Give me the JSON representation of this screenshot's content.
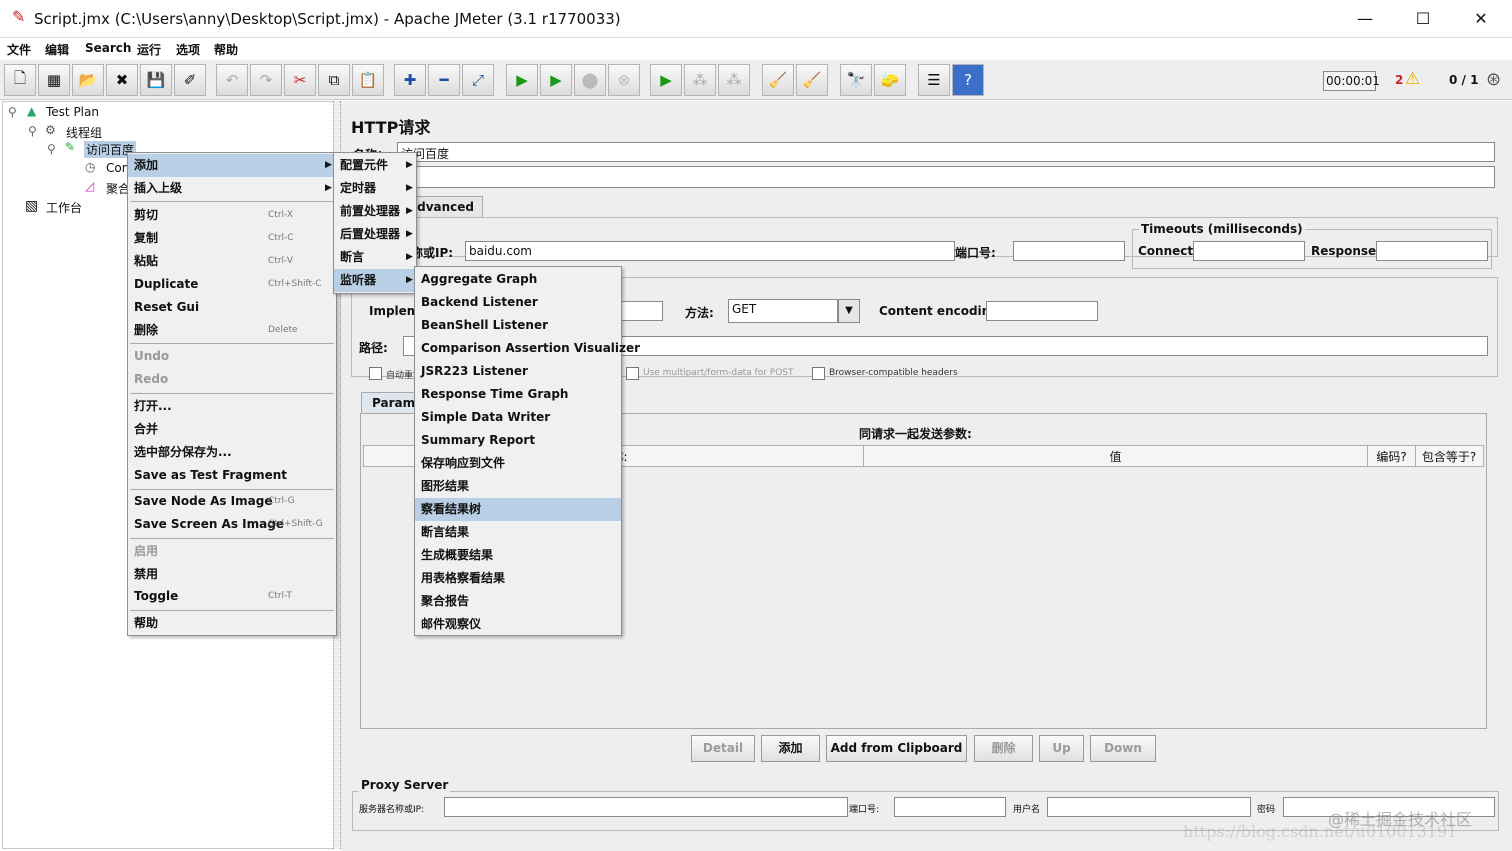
{
  "window": {
    "title": "Script.jmx (C:\\Users\\anny\\Desktop\\Script.jmx) - Apache JMeter (3.1 r1770033)",
    "minimize": "—",
    "maximize": "☐",
    "close": "✕"
  },
  "menubar": [
    "文件",
    "编辑",
    "Search",
    "运行",
    "选项",
    "帮助"
  ],
  "toolbar": {
    "timer": "00:00:01",
    "warnings": "2",
    "threads": "0 / 1"
  },
  "tree": {
    "items": [
      "Test Plan",
      "线程组",
      "访问百度",
      "Con",
      "聚合",
      "工作台"
    ]
  },
  "panel": {
    "title": "HTTP请求",
    "name_label": "名称：",
    "name_value": "访问百度",
    "tab_advanced": "Advanced",
    "timeouts_legend": "Timeouts (milliseconds)",
    "server_label": "服务器名称或IP:",
    "server_value": "baidu.com",
    "port_label": "端口号:",
    "connect_label": "Connect:",
    "response_label": "Response:",
    "impl_label": "Implementation:",
    "method_label": "方法:",
    "method_value": "GET",
    "encoding_label": "Content encoding:",
    "path_label": "路径:",
    "auto_redirect": "自动重定向",
    "multipart": "Use multipart/form-data for POST",
    "browser_headers": "Browser-compatible headers",
    "params_tab": "Parameters",
    "params_title": "同请求一起发送参数:",
    "col_name": "名称:",
    "col_value": "值",
    "col_encode": "编码?",
    "col_include": "包含等于?",
    "btn_detail": "Detail",
    "btn_add": "添加",
    "btn_clip": "Add from Clipboard",
    "btn_delete": "删除",
    "btn_up": "Up",
    "btn_down": "Down",
    "proxy_legend": "Proxy Server",
    "proxy_server": "服务器名称或IP:",
    "proxy_port": "端口号:",
    "proxy_user": "用户名",
    "proxy_pass": "密码"
  },
  "context_menu": {
    "items": [
      {
        "label": "添加",
        "arrow": "▶"
      },
      {
        "label": "插入上级",
        "arrow": "▶"
      },
      {
        "label": "剪切",
        "acc": "Ctrl-X"
      },
      {
        "label": "复制",
        "acc": "Ctrl-C"
      },
      {
        "label": "粘贴",
        "acc": "Ctrl-V"
      },
      {
        "label": "Duplicate",
        "acc": "Ctrl+Shift-C"
      },
      {
        "label": "Reset Gui"
      },
      {
        "label": "删除",
        "acc": "Delete"
      },
      {
        "label": "Undo"
      },
      {
        "label": "Redo"
      },
      {
        "label": "打开..."
      },
      {
        "label": "合并"
      },
      {
        "label": "选中部分保存为..."
      },
      {
        "label": "Save as Test Fragment"
      },
      {
        "label": "Save Node As Image",
        "acc": "Ctrl-G"
      },
      {
        "label": "Save Screen As Image",
        "acc": "Ctrl+Shift-G"
      },
      {
        "label": "启用"
      },
      {
        "label": "禁用"
      },
      {
        "label": "Toggle",
        "acc": "Ctrl-T"
      },
      {
        "label": "帮助"
      }
    ]
  },
  "submenu_add": [
    "配置元件",
    "定时器",
    "前置处理器",
    "后置处理器",
    "断言",
    "监听器"
  ],
  "submenu_listeners": [
    "Aggregate Graph",
    "Backend Listener",
    "BeanShell Listener",
    "Comparison Assertion Visualizer",
    "JSR223 Listener",
    "Response Time Graph",
    "Simple Data Writer",
    "Summary Report",
    "保存响应到文件",
    "图形结果",
    "察看结果树",
    "断言结果",
    "生成概要结果",
    "用表格察看结果",
    "聚合报告",
    "邮件观察仪"
  ],
  "watermark": {
    "line1": "@稀土掘金技术社区",
    "line2": "https://blog.csdn.net/u010013191"
  },
  "colors": {
    "highlight": "#b8cfe5",
    "menu_bg": "#f0f0f0",
    "panel_bg": "#eeeeee"
  }
}
